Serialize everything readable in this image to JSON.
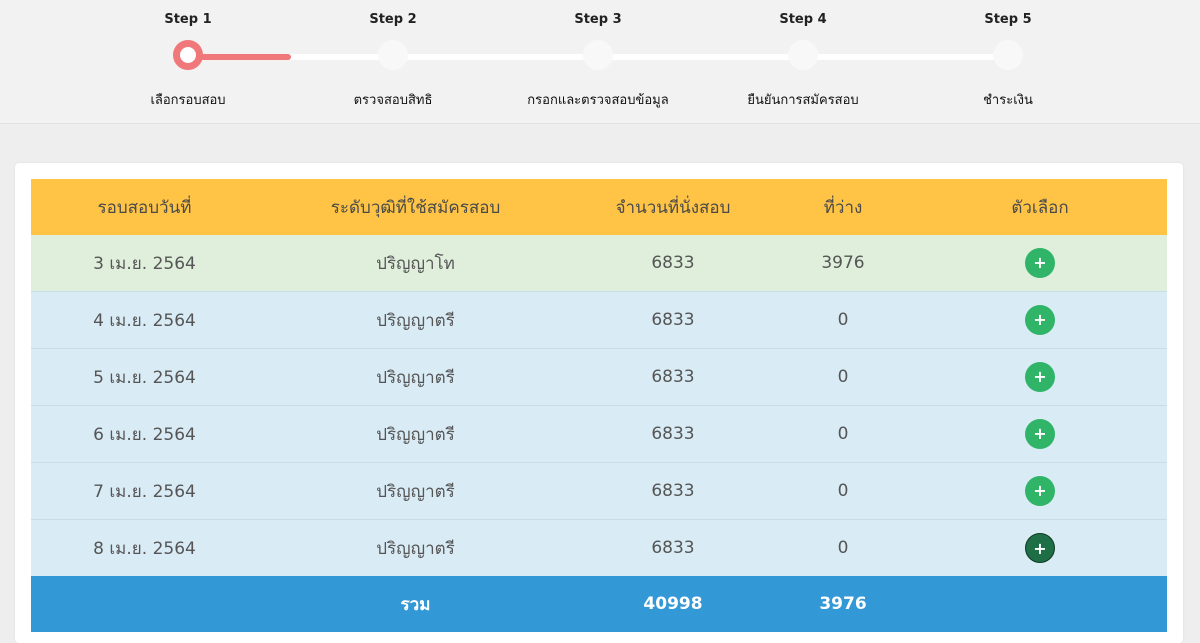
{
  "steps": [
    {
      "top": "Step 1",
      "bottom": "เลือกรอบสอบ",
      "active": true
    },
    {
      "top": "Step 2",
      "bottom": "ตรวจสอบสิทธิ",
      "active": false
    },
    {
      "top": "Step 3",
      "bottom": "กรอกและตรวจสอบข้อมูล",
      "active": false
    },
    {
      "top": "Step 4",
      "bottom": "ยืนยันการสมัครสอบ",
      "active": false
    },
    {
      "top": "Step 5",
      "bottom": "ชำระเงิน",
      "active": false
    }
  ],
  "table": {
    "headers": [
      "รอบสอบวันที่",
      "ระดับวุฒิที่ใช้สมัครสอบ",
      "จำนวนที่นั่งสอบ",
      "ที่ว่าง",
      "ตัวเลือก"
    ],
    "rows": [
      {
        "date": "3 เม.ย. 2564",
        "level": "ปริญญาโท",
        "seats": "6833",
        "available": "3976",
        "action": "+"
      },
      {
        "date": "4 เม.ย. 2564",
        "level": "ปริญญาตรี",
        "seats": "6833",
        "available": "0",
        "action": "+"
      },
      {
        "date": "5 เม.ย. 2564",
        "level": "ปริญญาตรี",
        "seats": "6833",
        "available": "0",
        "action": "+"
      },
      {
        "date": "6 เม.ย. 2564",
        "level": "ปริญญาตรี",
        "seats": "6833",
        "available": "0",
        "action": "+"
      },
      {
        "date": "7 เม.ย. 2564",
        "level": "ปริญญาตรี",
        "seats": "6833",
        "available": "0",
        "action": "+"
      },
      {
        "date": "8 เม.ย. 2564",
        "level": "ปริญญาตรี",
        "seats": "6833",
        "available": "0",
        "action": "+"
      }
    ],
    "footer": {
      "label": "รวม",
      "seats": "40998",
      "available": "3976"
    }
  },
  "colors": {
    "accent": "#f0787b",
    "header": "#ffc445",
    "footer": "#3399d6",
    "row_open": "#dfefdb",
    "row_full": "#d9ebf5",
    "add_button": "#2fb468"
  },
  "icons": {
    "add": "plus-icon"
  }
}
